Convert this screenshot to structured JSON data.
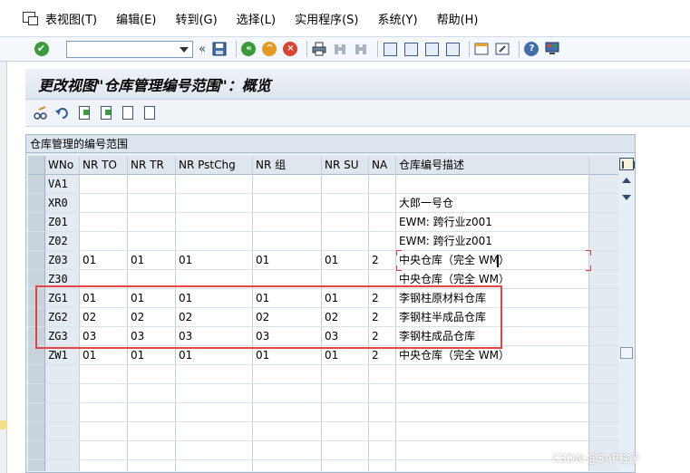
{
  "menu": {
    "items": [
      "表视图(T)",
      "编辑(E)",
      "转到(G)",
      "选择(L)",
      "实用程序(S)",
      "系统(Y)",
      "帮助(H)"
    ]
  },
  "toolbar": {
    "command_value": "",
    "nav_back_glyph": "«"
  },
  "title": "更改视图\"仓库管理编号范围\"：概览",
  "table": {
    "caption": "仓库管理的编号范围",
    "columns": [
      "WNo",
      "NR TO",
      "NR TR",
      "NR PstChg",
      "NR 组",
      "NR SU",
      "NA",
      "仓库编号描述"
    ],
    "rows": [
      [
        "VA1",
        "",
        "",
        "",
        "",
        "",
        "",
        ""
      ],
      [
        "XR0",
        "",
        "",
        "",
        "",
        "",
        "",
        "大郎一号仓"
      ],
      [
        "Z01",
        "",
        "",
        "",
        "",
        "",
        "",
        "EWM: 跨行业z001"
      ],
      [
        "Z02",
        "",
        "",
        "",
        "",
        "",
        "",
        "EWM: 跨行业z001"
      ],
      [
        "Z03",
        "01",
        "01",
        "01",
        "01",
        "01",
        "2",
        "中央仓库（完全 WM）"
      ],
      [
        "Z30",
        "",
        "",
        "",
        "",
        "",
        "",
        "中央仓库（完全 WM）"
      ],
      [
        "ZG1",
        "01",
        "01",
        "01",
        "01",
        "01",
        "2",
        "李钢柱原材料仓库"
      ],
      [
        "ZG2",
        "02",
        "02",
        "02",
        "02",
        "02",
        "2",
        "李钢柱半成品仓库"
      ],
      [
        "ZG3",
        "03",
        "03",
        "03",
        "03",
        "03",
        "2",
        "李钢柱成品仓库"
      ],
      [
        "ZW1",
        "01",
        "01",
        "01",
        "01",
        "01",
        "2",
        "中央仓库（完全 WM）"
      ]
    ]
  },
  "watermark": "CSDN @SAP柱子"
}
